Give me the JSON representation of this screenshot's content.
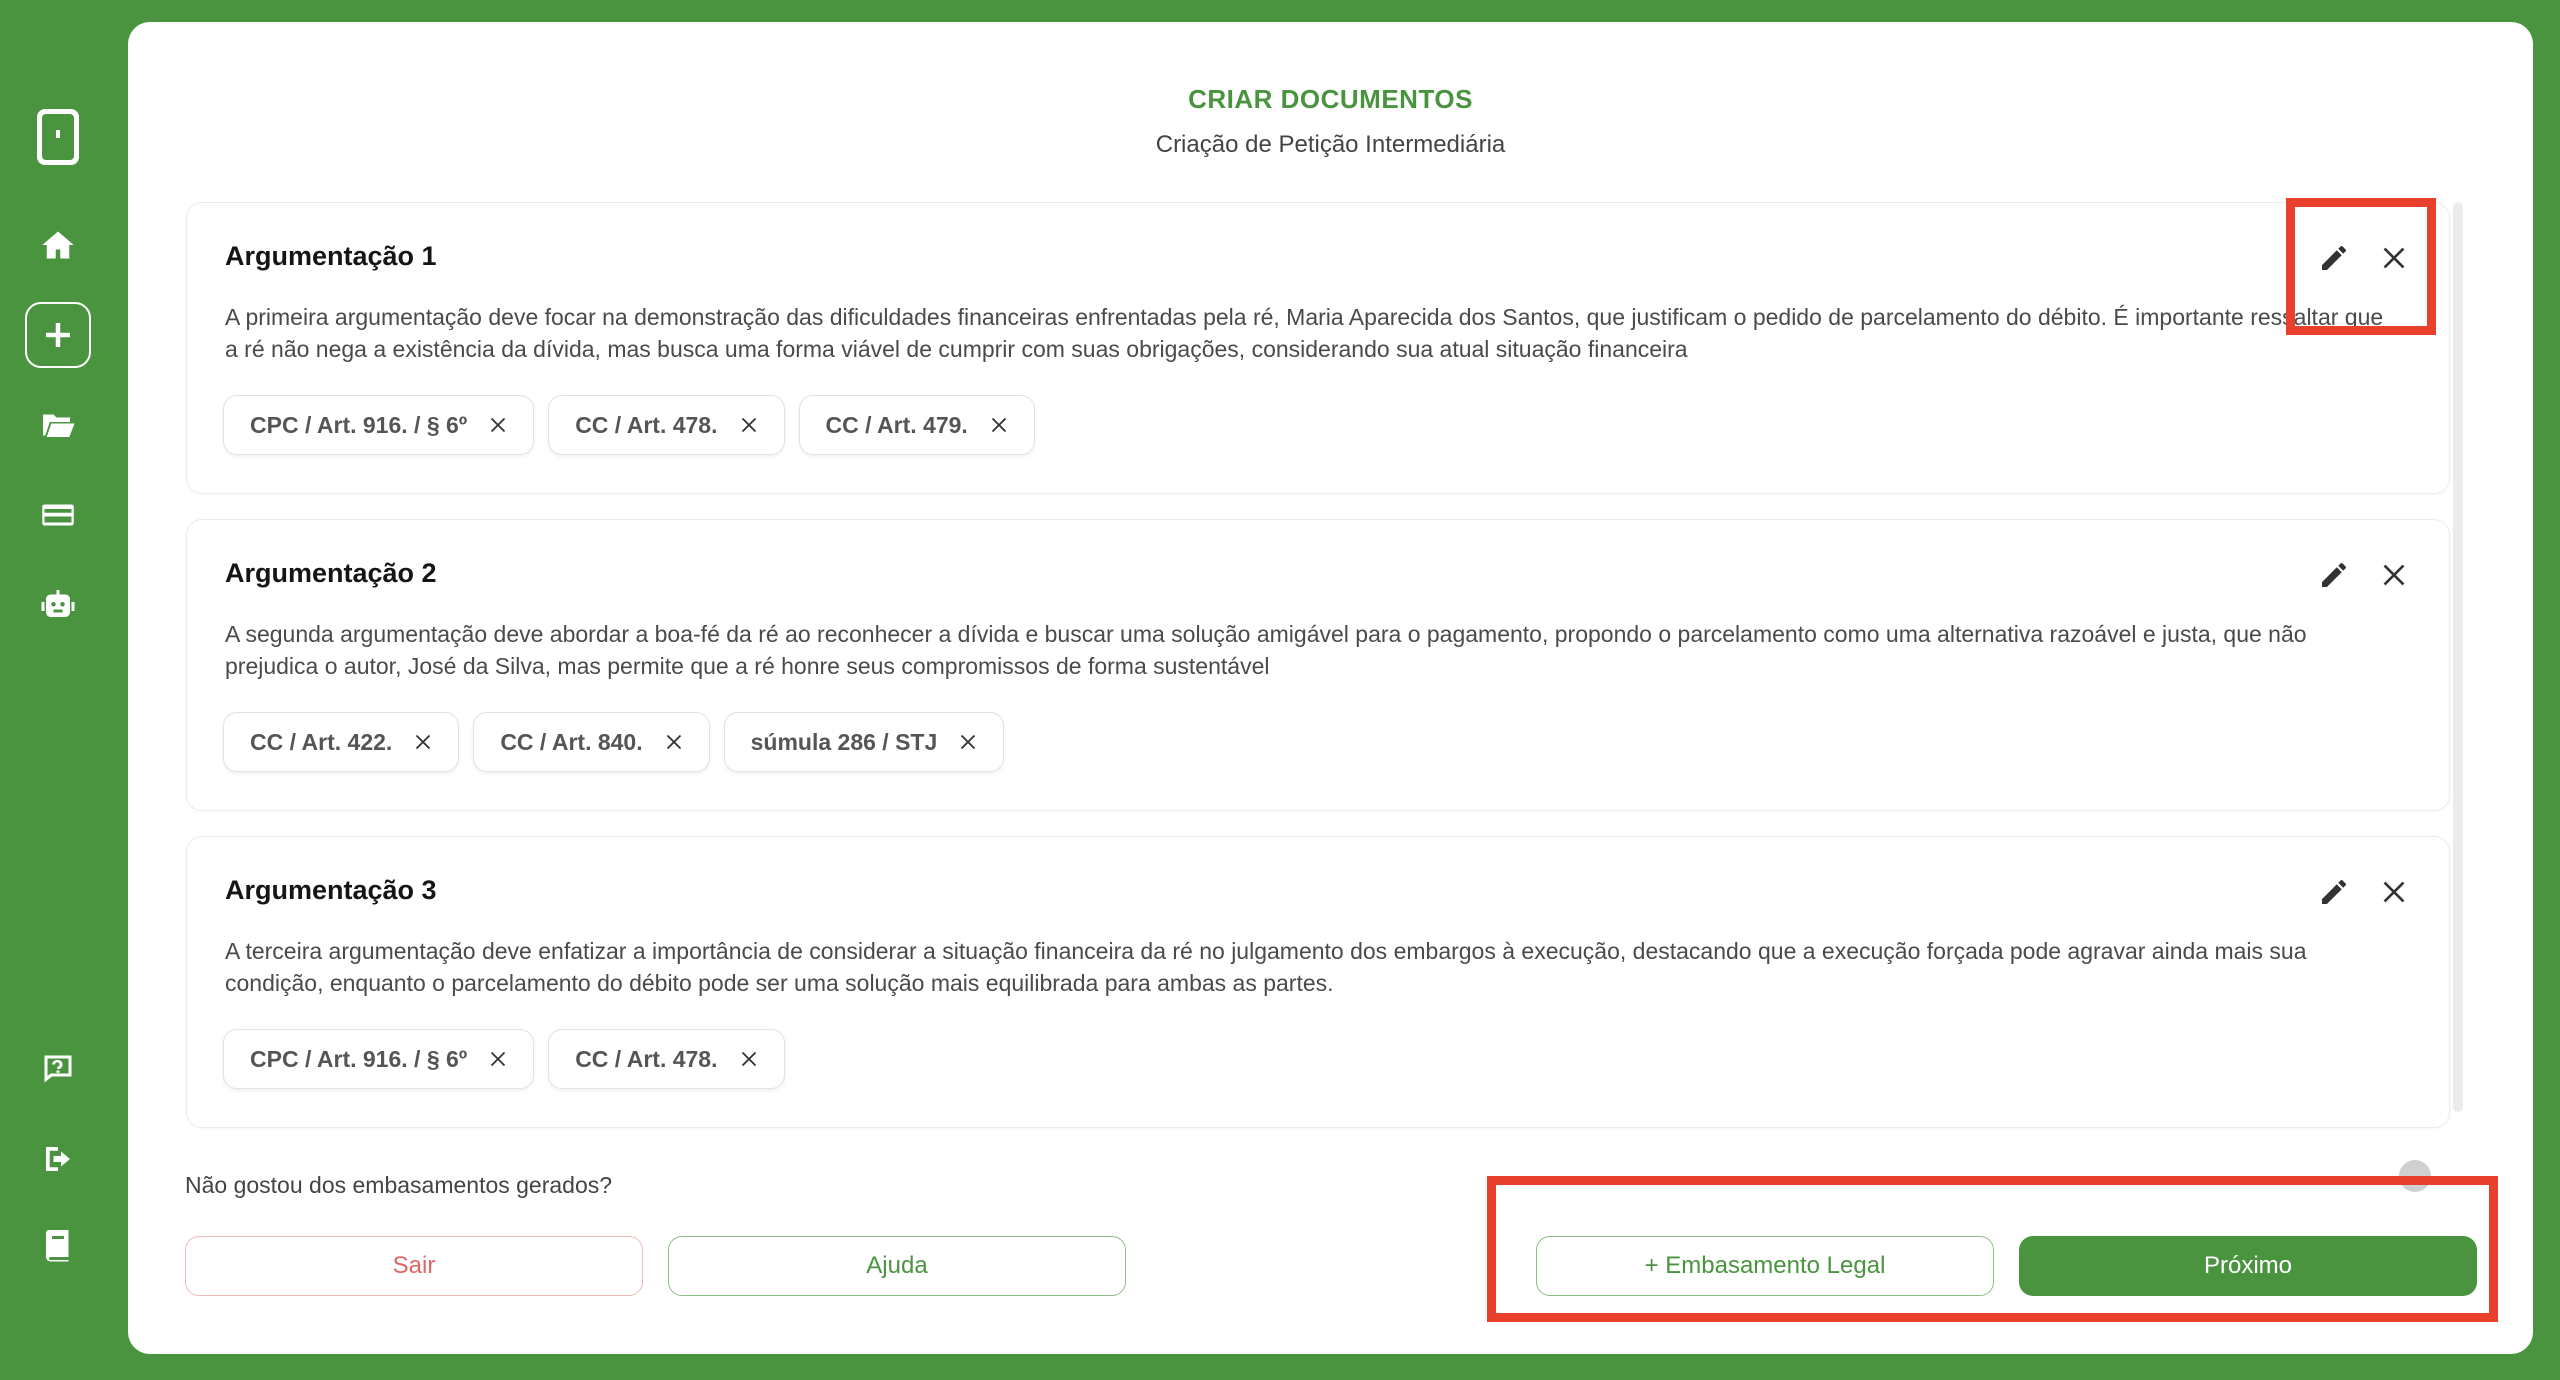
{
  "header": {
    "title": "CRIAR DOCUMENTOS",
    "subtitle": "Criação de Petição Intermediária"
  },
  "sidebar": {
    "items": [
      {
        "name": "logo",
        "icon": "phone-logo-icon"
      },
      {
        "name": "home",
        "icon": "home-icon"
      },
      {
        "name": "new",
        "icon": "plus-icon"
      },
      {
        "name": "folders",
        "icon": "folder-open-icon"
      },
      {
        "name": "billing",
        "icon": "credit-card-icon"
      },
      {
        "name": "assistant",
        "icon": "robot-icon"
      },
      {
        "name": "help",
        "icon": "help-chat-icon"
      },
      {
        "name": "logout",
        "icon": "sign-out-icon"
      },
      {
        "name": "docs",
        "icon": "book-icon"
      }
    ]
  },
  "arguments": [
    {
      "title": "Argumentação 1",
      "text": "A primeira argumentação deve focar na demonstração das dificuldades financeiras enfrentadas pela ré, Maria Aparecida dos Santos, que justificam o pedido de parcelamento do débito. É importante ressaltar que a ré não nega a existência da dívida, mas busca uma forma viável de cumprir com suas obrigações, considerando sua atual situação financeira",
      "tags": [
        "CPC / Art. 916. / § 6º",
        "CC / Art. 478.",
        "CC / Art. 479."
      ]
    },
    {
      "title": "Argumentação 2",
      "text": "A segunda argumentação deve abordar a boa-fé da ré ao reconhecer a dívida e buscar uma solução amigável para o pagamento, propondo o parcelamento como uma alternativa razoável e justa, que não prejudica o autor, José da Silva, mas permite que a ré honre seus compromissos de forma sustentável",
      "tags": [
        "CC / Art. 422.",
        "CC / Art. 840.",
        "súmula 286 / STJ"
      ]
    },
    {
      "title": "Argumentação 3",
      "text": "A terceira argumentação deve enfatizar a importância de considerar a situação financeira da ré no julgamento dos embargos à execução, destacando que a execução forçada pode agravar ainda mais sua condição, enquanto o parcelamento do débito pode ser uma solução mais equilibrada para ambas as partes.",
      "tags": [
        "CPC / Art. 916. / § 6º",
        "CC / Art. 478."
      ]
    }
  ],
  "footer": {
    "question": "Não gostou dos embasamentos gerados?",
    "sair_label": "Sair",
    "ajuda_label": "Ajuda",
    "embasamento_label": "+ Embasamento Legal",
    "proximo_label": "Próximo"
  },
  "colors": {
    "brand_green": "#4a9440",
    "highlight_red": "#e8402c",
    "danger": "#e06666"
  }
}
